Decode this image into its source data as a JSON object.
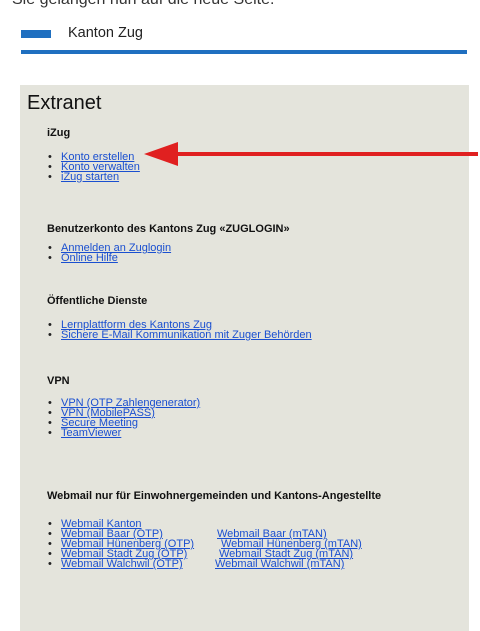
{
  "cut_text": "Sie gelangen nun auf die neue Seite.",
  "header": {
    "site_name": "Kanton Zug"
  },
  "panel": {
    "title": "Extranet"
  },
  "sections": {
    "izug": {
      "heading": "iZug",
      "links": [
        "Konto erstellen",
        "Konto verwalten",
        "iZug starten"
      ]
    },
    "zuglogin": {
      "heading": "Benutzerkonto des Kantons Zug «ZUGLOGIN»",
      "links": [
        "Anmelden an Zuglogin",
        "Online Hilfe"
      ]
    },
    "public": {
      "heading": "Öffentliche Dienste",
      "links": [
        "Lernplattform des Kantons Zug",
        "Sichere E-Mail Kommunikation mit Zuger Behörden"
      ]
    },
    "vpn": {
      "heading": "VPN",
      "links": [
        "VPN (OTP Zahlengenerator)",
        "VPN (MobilePASS)",
        "Secure Meeting",
        "TeamViewer"
      ]
    },
    "webmail": {
      "heading": "Webmail nur für Einwohnergemeinden und Kantons-Angestellte",
      "links": [
        "Webmail Kanton",
        "Webmail Baar (OTP)",
        "Webmail Hünenberg (OTP)",
        "Webmail Stadt Zug (OTP)",
        "Webmail Walchwil (OTP)"
      ],
      "links2": [
        "Webmail Baar (mTAN)",
        "Webmail Hünenberg (mTAN)",
        "Webmail Stadt Zug (mTAN)",
        "Webmail Walchwil (mTAN)"
      ]
    }
  },
  "colors": {
    "accent": "#1f6fc0",
    "link": "#1a4fd0",
    "panel_bg": "#e4e4dc",
    "arrow": "#e02020"
  },
  "icons": {
    "bullet": "•",
    "annotation": "red-arrow-icon"
  }
}
